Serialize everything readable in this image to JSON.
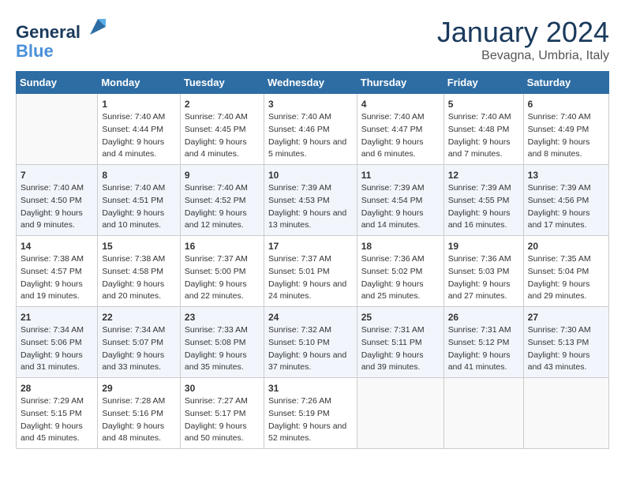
{
  "logo": {
    "line1": "General",
    "line2": "Blue"
  },
  "title": "January 2024",
  "subtitle": "Bevagna, Umbria, Italy",
  "days": [
    "Sunday",
    "Monday",
    "Tuesday",
    "Wednesday",
    "Thursday",
    "Friday",
    "Saturday"
  ],
  "weeks": [
    [
      {
        "num": "",
        "sunrise": "",
        "sunset": "",
        "daylight": ""
      },
      {
        "num": "1",
        "sunrise": "Sunrise: 7:40 AM",
        "sunset": "Sunset: 4:44 PM",
        "daylight": "Daylight: 9 hours and 4 minutes."
      },
      {
        "num": "2",
        "sunrise": "Sunrise: 7:40 AM",
        "sunset": "Sunset: 4:45 PM",
        "daylight": "Daylight: 9 hours and 4 minutes."
      },
      {
        "num": "3",
        "sunrise": "Sunrise: 7:40 AM",
        "sunset": "Sunset: 4:46 PM",
        "daylight": "Daylight: 9 hours and 5 minutes."
      },
      {
        "num": "4",
        "sunrise": "Sunrise: 7:40 AM",
        "sunset": "Sunset: 4:47 PM",
        "daylight": "Daylight: 9 hours and 6 minutes."
      },
      {
        "num": "5",
        "sunrise": "Sunrise: 7:40 AM",
        "sunset": "Sunset: 4:48 PM",
        "daylight": "Daylight: 9 hours and 7 minutes."
      },
      {
        "num": "6",
        "sunrise": "Sunrise: 7:40 AM",
        "sunset": "Sunset: 4:49 PM",
        "daylight": "Daylight: 9 hours and 8 minutes."
      }
    ],
    [
      {
        "num": "7",
        "sunrise": "Sunrise: 7:40 AM",
        "sunset": "Sunset: 4:50 PM",
        "daylight": "Daylight: 9 hours and 9 minutes."
      },
      {
        "num": "8",
        "sunrise": "Sunrise: 7:40 AM",
        "sunset": "Sunset: 4:51 PM",
        "daylight": "Daylight: 9 hours and 10 minutes."
      },
      {
        "num": "9",
        "sunrise": "Sunrise: 7:40 AM",
        "sunset": "Sunset: 4:52 PM",
        "daylight": "Daylight: 9 hours and 12 minutes."
      },
      {
        "num": "10",
        "sunrise": "Sunrise: 7:39 AM",
        "sunset": "Sunset: 4:53 PM",
        "daylight": "Daylight: 9 hours and 13 minutes."
      },
      {
        "num": "11",
        "sunrise": "Sunrise: 7:39 AM",
        "sunset": "Sunset: 4:54 PM",
        "daylight": "Daylight: 9 hours and 14 minutes."
      },
      {
        "num": "12",
        "sunrise": "Sunrise: 7:39 AM",
        "sunset": "Sunset: 4:55 PM",
        "daylight": "Daylight: 9 hours and 16 minutes."
      },
      {
        "num": "13",
        "sunrise": "Sunrise: 7:39 AM",
        "sunset": "Sunset: 4:56 PM",
        "daylight": "Daylight: 9 hours and 17 minutes."
      }
    ],
    [
      {
        "num": "14",
        "sunrise": "Sunrise: 7:38 AM",
        "sunset": "Sunset: 4:57 PM",
        "daylight": "Daylight: 9 hours and 19 minutes."
      },
      {
        "num": "15",
        "sunrise": "Sunrise: 7:38 AM",
        "sunset": "Sunset: 4:58 PM",
        "daylight": "Daylight: 9 hours and 20 minutes."
      },
      {
        "num": "16",
        "sunrise": "Sunrise: 7:37 AM",
        "sunset": "Sunset: 5:00 PM",
        "daylight": "Daylight: 9 hours and 22 minutes."
      },
      {
        "num": "17",
        "sunrise": "Sunrise: 7:37 AM",
        "sunset": "Sunset: 5:01 PM",
        "daylight": "Daylight: 9 hours and 24 minutes."
      },
      {
        "num": "18",
        "sunrise": "Sunrise: 7:36 AM",
        "sunset": "Sunset: 5:02 PM",
        "daylight": "Daylight: 9 hours and 25 minutes."
      },
      {
        "num": "19",
        "sunrise": "Sunrise: 7:36 AM",
        "sunset": "Sunset: 5:03 PM",
        "daylight": "Daylight: 9 hours and 27 minutes."
      },
      {
        "num": "20",
        "sunrise": "Sunrise: 7:35 AM",
        "sunset": "Sunset: 5:04 PM",
        "daylight": "Daylight: 9 hours and 29 minutes."
      }
    ],
    [
      {
        "num": "21",
        "sunrise": "Sunrise: 7:34 AM",
        "sunset": "Sunset: 5:06 PM",
        "daylight": "Daylight: 9 hours and 31 minutes."
      },
      {
        "num": "22",
        "sunrise": "Sunrise: 7:34 AM",
        "sunset": "Sunset: 5:07 PM",
        "daylight": "Daylight: 9 hours and 33 minutes."
      },
      {
        "num": "23",
        "sunrise": "Sunrise: 7:33 AM",
        "sunset": "Sunset: 5:08 PM",
        "daylight": "Daylight: 9 hours and 35 minutes."
      },
      {
        "num": "24",
        "sunrise": "Sunrise: 7:32 AM",
        "sunset": "Sunset: 5:10 PM",
        "daylight": "Daylight: 9 hours and 37 minutes."
      },
      {
        "num": "25",
        "sunrise": "Sunrise: 7:31 AM",
        "sunset": "Sunset: 5:11 PM",
        "daylight": "Daylight: 9 hours and 39 minutes."
      },
      {
        "num": "26",
        "sunrise": "Sunrise: 7:31 AM",
        "sunset": "Sunset: 5:12 PM",
        "daylight": "Daylight: 9 hours and 41 minutes."
      },
      {
        "num": "27",
        "sunrise": "Sunrise: 7:30 AM",
        "sunset": "Sunset: 5:13 PM",
        "daylight": "Daylight: 9 hours and 43 minutes."
      }
    ],
    [
      {
        "num": "28",
        "sunrise": "Sunrise: 7:29 AM",
        "sunset": "Sunset: 5:15 PM",
        "daylight": "Daylight: 9 hours and 45 minutes."
      },
      {
        "num": "29",
        "sunrise": "Sunrise: 7:28 AM",
        "sunset": "Sunset: 5:16 PM",
        "daylight": "Daylight: 9 hours and 48 minutes."
      },
      {
        "num": "30",
        "sunrise": "Sunrise: 7:27 AM",
        "sunset": "Sunset: 5:17 PM",
        "daylight": "Daylight: 9 hours and 50 minutes."
      },
      {
        "num": "31",
        "sunrise": "Sunrise: 7:26 AM",
        "sunset": "Sunset: 5:19 PM",
        "daylight": "Daylight: 9 hours and 52 minutes."
      },
      {
        "num": "",
        "sunrise": "",
        "sunset": "",
        "daylight": ""
      },
      {
        "num": "",
        "sunrise": "",
        "sunset": "",
        "daylight": ""
      },
      {
        "num": "",
        "sunrise": "",
        "sunset": "",
        "daylight": ""
      }
    ]
  ]
}
